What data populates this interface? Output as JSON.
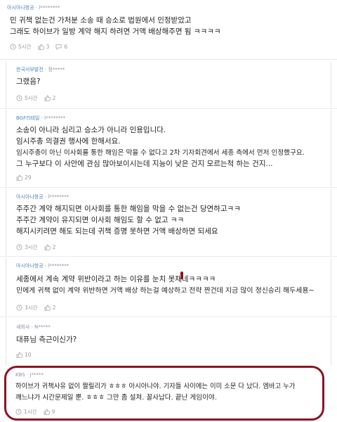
{
  "comments": [
    {
      "source": "아시아나항공",
      "author": "l********",
      "lines": [
        "민 귀책 없는건 가처분 소송 때 승소로 법원에서 인정받았고",
        "그래도 하이브가 일방 계약 해지 하려면 거액 배상해주면 됨 ㅋㅋㅋㅋ"
      ],
      "time": "5시간",
      "likes": "3",
      "replies": "6"
    },
    {
      "source": "한국서부발전",
      "author": "정*****",
      "lines": [
        "그랬음?"
      ],
      "time": "5시간",
      "likes": "2"
    },
    {
      "source": "BGF리테일",
      "author": "l********",
      "lines": [
        "소송이 아니라 심리고 승소가 아니라 인용입니다.",
        "임시주총 의결권 행사에 한해서요.",
        "임시주총이 아닌 이사회를 통한 해임은 막을 수 없다고 2차 기자회견에서 세종 측에서 먼저 인정했구요.",
        "그 누구보다 이 사안에 관심 많아보이시는데 지능이 낮은 건지 모르는척 하는 건지..."
      ],
      "likes": "29"
    },
    {
      "source": "아시아나항공",
      "author": "l********",
      "lines": [
        "주주간 계약 해지되면 이사회를 통한 해임을 막을 수 없는건 당연하고ㅋㅋ",
        "주주간 계약이 유지되면 이사회 해임도 할 수 없고 ㅋㅋ",
        "해지시키려면 해도 되는데 귀책 증명 못하면 거액 배상하면 되세요"
      ],
      "time": "3시간",
      "likes": "2"
    },
    {
      "source": "아시아나항공",
      "author": "l********",
      "lines": [
        "세종에서 계속 계약 위반이라고 하는 이유를 눈치 못채네ㅋㅋㅋㅋ",
        "민에게 귀책 없이 계약 위반하면 거액 배상 하는걸 예상하고 전략 짠건데 지금 많이 정신승리 해두세용~"
      ],
      "time": "3시간",
      "likes": "2"
    },
    {
      "source": "새회사",
      "author": "N*****",
      "lines": [
        "대퓨님 측근이신가?"
      ],
      "likes": "10"
    },
    {
      "source": "KBS",
      "author": "j*****",
      "lines": [
        "하이브가 귀책사유 없이 짤릴리가 ㅎㅎㅎ 아시아나야. 기자들 사이에는 이미 소문 다 났다. 엠바고 누가",
        "깨느냐가 시간문제일 뿐. ㅎㅎㅎ 그만 좀 설쳐. 꼴사납다. 끝난 게임이야."
      ],
      "time": "1시간",
      "likes": "9"
    }
  ],
  "colors": {
    "accent": "#4e7fc2",
    "highlight": "#8c1422"
  }
}
